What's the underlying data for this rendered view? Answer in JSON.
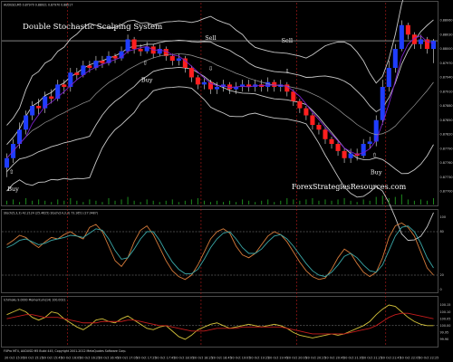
{
  "chart_data": [
    {
      "type": "candlestick",
      "title": "Double Stochastic  Scalping System",
      "header": "AUDUSD,M5  0.87970 0.88021 0.87970 0.88017",
      "watermark": "ForexStrategiesResources.com",
      "y_ticks": [
        "0.88060",
        "0.88030",
        "0.88000",
        "0.87970",
        "0.87940",
        "0.87910",
        "0.87880",
        "0.87850",
        "0.87820",
        "0.87790",
        "0.87760",
        "0.87730",
        "0.87700"
      ],
      "current_price": 0.88017,
      "colors": {
        "bull": "#1f3dff",
        "bear": "#ff1f1f",
        "bands": "#c8c8c8",
        "ma_fast": "#7a1fc9",
        "ma_slow": "#9a9a9a",
        "current_line": "#cfcfcf",
        "session_line": "#b81c1c",
        "volume": "#1e8a1e"
      },
      "signals": [
        {
          "label": "Buy",
          "arrow": "up",
          "candle": 1
        },
        {
          "label": "Buy",
          "arrow": "up",
          "candle": 22
        },
        {
          "label": "Sell",
          "arrow": "down",
          "candle": 32
        },
        {
          "label": "Sell",
          "arrow": "down",
          "candle": 44
        },
        {
          "label": "Buy",
          "arrow": "up",
          "candle": 58
        }
      ],
      "candles": [
        {
          "o": 0.8775,
          "c": 0.8777,
          "h": 0.8778,
          "l": 0.8773
        },
        {
          "o": 0.8777,
          "c": 0.878,
          "h": 0.8781,
          "l": 0.8776
        },
        {
          "o": 0.878,
          "c": 0.8783,
          "h": 0.87845,
          "l": 0.8779
        },
        {
          "o": 0.8783,
          "c": 0.8786,
          "h": 0.8787,
          "l": 0.8782
        },
        {
          "o": 0.8786,
          "c": 0.8788,
          "h": 0.8789,
          "l": 0.8785
        },
        {
          "o": 0.8788,
          "c": 0.87875,
          "h": 0.87895,
          "l": 0.8786
        },
        {
          "o": 0.87875,
          "c": 0.879,
          "h": 0.8791,
          "l": 0.87865
        },
        {
          "o": 0.879,
          "c": 0.87895,
          "h": 0.87915,
          "l": 0.87885
        },
        {
          "o": 0.87895,
          "c": 0.87925,
          "h": 0.87935,
          "l": 0.8789
        },
        {
          "o": 0.87925,
          "c": 0.8792,
          "h": 0.87935,
          "l": 0.87905
        },
        {
          "o": 0.8792,
          "c": 0.8795,
          "h": 0.8796,
          "l": 0.8791
        },
        {
          "o": 0.8795,
          "c": 0.87945,
          "h": 0.8796,
          "l": 0.87935
        },
        {
          "o": 0.87945,
          "c": 0.87965,
          "h": 0.87975,
          "l": 0.8794
        },
        {
          "o": 0.87965,
          "c": 0.8796,
          "h": 0.87975,
          "l": 0.8795
        },
        {
          "o": 0.8796,
          "c": 0.87975,
          "h": 0.87985,
          "l": 0.87955
        },
        {
          "o": 0.87975,
          "c": 0.8797,
          "h": 0.87985,
          "l": 0.8796
        },
        {
          "o": 0.8797,
          "c": 0.87985,
          "h": 0.87995,
          "l": 0.87965
        },
        {
          "o": 0.87985,
          "c": 0.8798,
          "h": 0.8799,
          "l": 0.8797
        },
        {
          "o": 0.8798,
          "c": 0.87995,
          "h": 0.88005,
          "l": 0.87975
        },
        {
          "o": 0.87995,
          "c": 0.8802,
          "h": 0.8803,
          "l": 0.8799
        },
        {
          "o": 0.8802,
          "c": 0.88,
          "h": 0.88025,
          "l": 0.8799
        },
        {
          "o": 0.88,
          "c": 0.87995,
          "h": 0.8801,
          "l": 0.87985
        },
        {
          "o": 0.87995,
          "c": 0.88005,
          "h": 0.88015,
          "l": 0.8799
        },
        {
          "o": 0.88005,
          "c": 0.8799,
          "h": 0.8801,
          "l": 0.8798
        },
        {
          "o": 0.8799,
          "c": 0.88,
          "h": 0.8801,
          "l": 0.87985
        },
        {
          "o": 0.88,
          "c": 0.87985,
          "h": 0.88005,
          "l": 0.87975
        },
        {
          "o": 0.87985,
          "c": 0.87975,
          "h": 0.8799,
          "l": 0.87965
        },
        {
          "o": 0.87975,
          "c": 0.8798,
          "h": 0.8799,
          "l": 0.87965
        },
        {
          "o": 0.8798,
          "c": 0.8796,
          "h": 0.87985,
          "l": 0.8795
        },
        {
          "o": 0.8796,
          "c": 0.8794,
          "h": 0.87965,
          "l": 0.8793
        },
        {
          "o": 0.8794,
          "c": 0.87925,
          "h": 0.87945,
          "l": 0.87915
        },
        {
          "o": 0.87925,
          "c": 0.8793,
          "h": 0.8794,
          "l": 0.87915
        },
        {
          "o": 0.8793,
          "c": 0.87915,
          "h": 0.87935,
          "l": 0.87905
        },
        {
          "o": 0.87915,
          "c": 0.8792,
          "h": 0.8793,
          "l": 0.87905
        },
        {
          "o": 0.8792,
          "c": 0.87925,
          "h": 0.87935,
          "l": 0.8791
        },
        {
          "o": 0.87925,
          "c": 0.87915,
          "h": 0.8793,
          "l": 0.87905
        },
        {
          "o": 0.87915,
          "c": 0.8792,
          "h": 0.8793,
          "l": 0.87905
        },
        {
          "o": 0.8792,
          "c": 0.87925,
          "h": 0.87935,
          "l": 0.8791
        },
        {
          "o": 0.87925,
          "c": 0.8792,
          "h": 0.87935,
          "l": 0.8791
        },
        {
          "o": 0.8792,
          "c": 0.87925,
          "h": 0.87935,
          "l": 0.8791
        },
        {
          "o": 0.87925,
          "c": 0.8792,
          "h": 0.87935,
          "l": 0.8791
        },
        {
          "o": 0.8792,
          "c": 0.8793,
          "h": 0.8794,
          "l": 0.8791
        },
        {
          "o": 0.8793,
          "c": 0.8792,
          "h": 0.87935,
          "l": 0.8791
        },
        {
          "o": 0.8792,
          "c": 0.87925,
          "h": 0.87935,
          "l": 0.8791
        },
        {
          "o": 0.87925,
          "c": 0.8791,
          "h": 0.8793,
          "l": 0.879
        },
        {
          "o": 0.8791,
          "c": 0.8789,
          "h": 0.87915,
          "l": 0.8788
        },
        {
          "o": 0.8789,
          "c": 0.87875,
          "h": 0.87895,
          "l": 0.87865
        },
        {
          "o": 0.87875,
          "c": 0.8786,
          "h": 0.8788,
          "l": 0.8785
        },
        {
          "o": 0.8786,
          "c": 0.8784,
          "h": 0.87865,
          "l": 0.8783
        },
        {
          "o": 0.8784,
          "c": 0.8783,
          "h": 0.87845,
          "l": 0.8782
        },
        {
          "o": 0.8783,
          "c": 0.8781,
          "h": 0.87835,
          "l": 0.878
        },
        {
          "o": 0.8781,
          "c": 0.878,
          "h": 0.87815,
          "l": 0.8779
        },
        {
          "o": 0.878,
          "c": 0.87785,
          "h": 0.87805,
          "l": 0.87775
        },
        {
          "o": 0.87785,
          "c": 0.8777,
          "h": 0.8779,
          "l": 0.8776
        },
        {
          "o": 0.8777,
          "c": 0.8778,
          "h": 0.8779,
          "l": 0.8776
        },
        {
          "o": 0.8778,
          "c": 0.87775,
          "h": 0.8779,
          "l": 0.87765
        },
        {
          "o": 0.87775,
          "c": 0.878,
          "h": 0.8781,
          "l": 0.8777
        },
        {
          "o": 0.878,
          "c": 0.87805,
          "h": 0.87815,
          "l": 0.8779
        },
        {
          "o": 0.87805,
          "c": 0.8785,
          "h": 0.8786,
          "l": 0.87795
        },
        {
          "o": 0.8785,
          "c": 0.8792,
          "h": 0.87935,
          "l": 0.8784
        },
        {
          "o": 0.8792,
          "c": 0.8796,
          "h": 0.87975,
          "l": 0.8791
        },
        {
          "o": 0.8796,
          "c": 0.88,
          "h": 0.8801,
          "l": 0.8795
        },
        {
          "o": 0.88,
          "c": 0.8805,
          "h": 0.8806,
          "l": 0.87995
        },
        {
          "o": 0.8805,
          "c": 0.8803,
          "h": 0.88055,
          "l": 0.8802
        },
        {
          "o": 0.8803,
          "c": 0.8801,
          "h": 0.88035,
          "l": 0.88
        },
        {
          "o": 0.8801,
          "c": 0.8802,
          "h": 0.8803,
          "l": 0.88
        },
        {
          "o": 0.8802,
          "c": 0.88,
          "h": 0.88025,
          "l": 0.8799
        },
        {
          "o": 0.88,
          "c": 0.88017,
          "h": 0.88021,
          "l": 0.8797
        }
      ],
      "session_breaks_after_candle": [
        9,
        30,
        45,
        59
      ],
      "volume": [
        3,
        4,
        2,
        5,
        3,
        4,
        3,
        2,
        4,
        3,
        5,
        3,
        2,
        4,
        3,
        2,
        5,
        3,
        4,
        6,
        3,
        2,
        4,
        3,
        2,
        3,
        4,
        2,
        3,
        4,
        5,
        3,
        2,
        3,
        2,
        3,
        2,
        4,
        3,
        2,
        3,
        4,
        2,
        3,
        5,
        4,
        3,
        4,
        5,
        3,
        4,
        3,
        4,
        5,
        3,
        2,
        4,
        3,
        6,
        7,
        5,
        6,
        8,
        4,
        3,
        4,
        3,
        5
      ]
    },
    {
      "type": "line",
      "header": "Stoch(5,3,3) 42.2124 (25.4625)  Stoch(14,3,3) 73.1651 (27.0487)",
      "ylim": [
        0,
        100
      ],
      "y_ticks": [
        "100",
        "80",
        "20",
        "0"
      ],
      "levels": [
        80,
        20
      ],
      "series": [
        {
          "color": "#d47a3a",
          "values": [
            62,
            68,
            75,
            72,
            64,
            58,
            66,
            72,
            70,
            76,
            80,
            74,
            70,
            86,
            90,
            80,
            60,
            40,
            32,
            44,
            66,
            82,
            88,
            76,
            58,
            40,
            26,
            18,
            14,
            20,
            34,
            52,
            70,
            80,
            84,
            78,
            60,
            48,
            44,
            50,
            62,
            74,
            80,
            76,
            66,
            52,
            38,
            26,
            18,
            14,
            16,
            28,
            44,
            56,
            50,
            36,
            24,
            18,
            24,
            44,
            72,
            88,
            92,
            86,
            74,
            52,
            30,
            20
          ]
        },
        {
          "color": "#3aa8a8",
          "values": [
            58,
            62,
            68,
            70,
            66,
            62,
            64,
            68,
            70,
            72,
            75,
            74,
            72,
            78,
            84,
            82,
            70,
            54,
            42,
            44,
            56,
            70,
            80,
            80,
            68,
            52,
            38,
            28,
            22,
            22,
            28,
            42,
            58,
            70,
            78,
            80,
            70,
            58,
            50,
            50,
            56,
            66,
            74,
            76,
            70,
            60,
            48,
            36,
            26,
            20,
            18,
            24,
            34,
            46,
            50,
            44,
            34,
            26,
            24,
            34,
            54,
            74,
            86,
            88,
            80,
            64,
            44,
            30
          ]
        }
      ]
    },
    {
      "type": "line",
      "header": "Ichimoku 9.0000  Momentum(14) 100.0021",
      "y_ticks": [
        "100.15",
        "100.10",
        "100.05",
        "100.00",
        "99.95",
        "99.90"
      ],
      "levels": [
        100.0
      ],
      "series": [
        {
          "color": "#d4c23a",
          "values": [
            100.08,
            100.1,
            100.12,
            100.1,
            100.06,
            100.04,
            100.06,
            100.1,
            100.09,
            100.05,
            100.02,
            99.99,
            99.97,
            100.0,
            100.04,
            100.05,
            100.03,
            100.02,
            100.05,
            100.07,
            100.04,
            100.01,
            99.98,
            99.97,
            99.99,
            100.0,
            99.96,
            99.92,
            99.9,
            99.93,
            99.97,
            99.99,
            100.01,
            100.02,
            100.0,
            99.98,
            99.99,
            100.0,
            100.01,
            100.0,
            99.99,
            100.0,
            100.01,
            100.0,
            99.98,
            99.95,
            99.93,
            99.92,
            99.91,
            99.92,
            99.93,
            99.94,
            99.93,
            99.94,
            99.96,
            99.98,
            100.0,
            100.03,
            100.08,
            100.12,
            100.15,
            100.14,
            100.1,
            100.06,
            100.03,
            100.01,
            100.0,
            100.0
          ]
        },
        {
          "color": "#c41c1c",
          "values": [
            100.05,
            100.06,
            100.07,
            100.08,
            100.08,
            100.07,
            100.06,
            100.06,
            100.06,
            100.05,
            100.04,
            100.03,
            100.02,
            100.02,
            100.02,
            100.03,
            100.03,
            100.03,
            100.03,
            100.04,
            100.04,
            100.03,
            100.02,
            100.01,
            100.0,
            100.0,
            99.99,
            99.98,
            99.97,
            99.96,
            99.96,
            99.96,
            99.97,
            99.98,
            99.98,
            99.98,
            99.98,
            99.99,
            99.99,
            99.99,
            99.99,
            99.99,
            99.99,
            99.99,
            99.98,
            99.97,
            99.96,
            99.95,
            99.94,
            99.94,
            99.94,
            99.94,
            99.94,
            99.94,
            99.95,
            99.96,
            99.97,
            99.98,
            100.0,
            100.03,
            100.06,
            100.08,
            100.09,
            100.09,
            100.08,
            100.07,
            100.06,
            100.05
          ]
        }
      ]
    }
  ],
  "footer": "FXPro MT4, AUDUSD M5 Build 445, Copyright 2001-2012 MetaQuotes Software Corp.",
  "time_labels": [
    "20 Oct 15:05",
    "20 Oct 15:25",
    "20 Oct 15:45",
    "20 Oct 16:05",
    "20 Oct 16:25",
    "20 Oct 16:45",
    "20 Oct 17:05",
    "20 Oct 17:25",
    "20 Oct 17:45",
    "20 Oct 18:05",
    "20 Oct 18:25",
    "20 Oct 18:45",
    "20 Oct 19:05",
    "20 Oct 19:25",
    "20 Oct 19:45",
    "20 Oct 20:05",
    "20 Oct 20:25",
    "20 Oct 20:45",
    "20 Oct 21:05",
    "20 Oct 21:25",
    "20 Oct 21:45",
    "20 Oct 22:05",
    "20 Oct 22:25"
  ]
}
